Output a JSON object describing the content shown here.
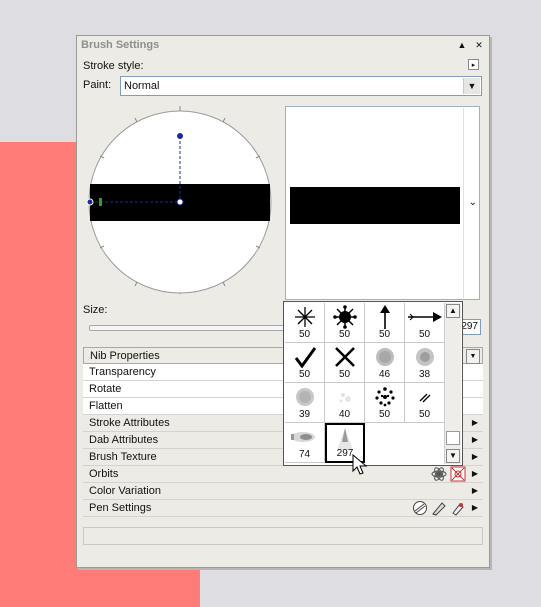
{
  "window": {
    "title": "Brush Settings",
    "pin_icon": "pin-up-icon",
    "close_icon": "close-icon"
  },
  "stroke_style": {
    "label": "Stroke style:"
  },
  "paint": {
    "label": "Paint:",
    "value": "Normal"
  },
  "size": {
    "label": "Size:",
    "value": "297"
  },
  "nib_picker": {
    "items": [
      {
        "icon": "asterisk-nib-icon",
        "value": "50"
      },
      {
        "icon": "virus-nib-icon",
        "value": "50"
      },
      {
        "icon": "up-arrow-nib-icon",
        "value": "50"
      },
      {
        "icon": "right-arrow-nib-icon",
        "value": "50"
      },
      {
        "icon": "checkmark-nib-icon",
        "value": "50"
      },
      {
        "icon": "x-cross-nib-icon",
        "value": "50"
      },
      {
        "icon": "soft-dots-nib-icon",
        "value": "46"
      },
      {
        "icon": "grainy-dots-nib-icon",
        "value": "38"
      },
      {
        "icon": "fuzzy-circle-nib-icon",
        "value": "39"
      },
      {
        "icon": "faint-splash-nib-icon",
        "value": "40"
      },
      {
        "icon": "dotted-circle-nib-icon",
        "value": "50"
      },
      {
        "icon": "slash-lines-nib-icon",
        "value": "50"
      },
      {
        "icon": "smudge-nib-icon",
        "value": "74"
      },
      {
        "icon": "spray-cone-nib-icon",
        "value": "297"
      }
    ],
    "selected_index": 13
  },
  "properties": {
    "nib_header": "Nib Properties",
    "nib_rows": [
      "Transparency",
      "Rotate",
      "Flatten"
    ],
    "sections": [
      "Stroke Attributes",
      "Dab Attributes",
      "Brush Texture",
      "Orbits",
      "Color Variation",
      "Pen Settings"
    ]
  },
  "colors": {
    "accent": "#ff7c78",
    "panel": "#ecebe6",
    "background": "#dedde1"
  }
}
